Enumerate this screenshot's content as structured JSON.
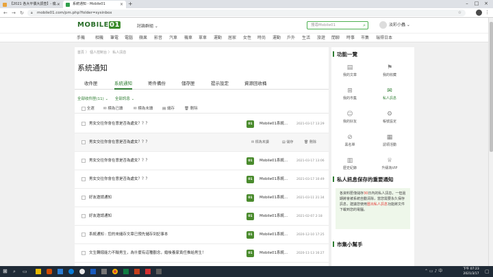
{
  "browser": {
    "tabs": [
      {
        "label": "【2021 各大平價大調查】- 瘋..."
      },
      {
        "label": "系統通知 - Mobile01"
      }
    ],
    "url": "mobile01.com/pm.php?folder=sysinbox"
  },
  "header": {
    "logo_text": "MOBILE",
    "logo_mark": "01",
    "forum_menu": "討論群組 ⌄",
    "search_placeholder": "搜尋Mobile01",
    "username": "淡彩小蟲 ⌄"
  },
  "categories": [
    "手機",
    "相機",
    "筆電",
    "電腦",
    "蘋果",
    "影音",
    "汽車",
    "機車",
    "單車",
    "運動",
    "居家",
    "女性",
    "時尚",
    "運動",
    "戶外",
    "生活",
    "旅遊",
    "閒聊",
    "時事",
    "市集",
    "瑞得日本"
  ],
  "breadcrumb": "首頁  〉 個人控制台  〉 私人訊息",
  "page_title": "系統通知",
  "tabs": [
    {
      "label": "收件匣"
    },
    {
      "label": "系統通知"
    },
    {
      "label": "寄件備份"
    },
    {
      "label": "儲存匣"
    },
    {
      "label": "提示設定"
    },
    {
      "label": "資源回收桶"
    }
  ],
  "filters": {
    "all_label": "全部收件匣(11) ⌄",
    "all_msgs": "全部訊息 ⌄"
  },
  "toolbar": {
    "select_all": "全選",
    "mark_read": "標為已讀",
    "mark_unread": "標為未讀",
    "save": "儲存",
    "delete": "刪除"
  },
  "row_actions": {
    "mark_unread": "標為未讀",
    "save": "儲存",
    "delete": "刪除"
  },
  "messages": [
    {
      "subject": "男女交往你會在意是否為處女？？？",
      "sender": "Mobile01系統...",
      "date": "2021-03-17 13:29"
    },
    {
      "subject": "男女交往你會在意是否為處女？？？",
      "sender": "",
      "date": ""
    },
    {
      "subject": "男女交往你會在意是否為處女？？？",
      "sender": "Mobile01系統...",
      "date": "2021-03-17 13:06"
    },
    {
      "subject": "男女交往你會在意是否為處女？？？",
      "sender": "Mobile01系統...",
      "date": "2021-03-17 10:49"
    },
    {
      "subject": "好友邀請通知",
      "sender": "Mobile01系統...",
      "date": "2021-03-11 21:34"
    },
    {
      "subject": "好友邀請通知",
      "sender": "Mobile01系統...",
      "date": "2021-02-07 2:18"
    },
    {
      "subject": "系統通知 : 您的來儲存文章已預先儲存到記事本",
      "sender": "Mobile01系統...",
      "date": "2020-12-10 17:25"
    },
    {
      "subject": "文生轉錢能力不輸男生，為什麼有這種觀念，婚後養家責任推給男生！",
      "sender": "Mobile01系統...",
      "date": "2020-11-13 16:27"
    }
  ],
  "sidebar": {
    "title": "功能一覽",
    "items": [
      {
        "label": "我的文章",
        "icon": "document-icon"
      },
      {
        "label": "我的收藏",
        "icon": "bookmark-icon"
      },
      {
        "label": "我的市集",
        "icon": "basket-icon"
      },
      {
        "label": "私人訊息",
        "icon": "mail-icon"
      },
      {
        "label": "我的好友",
        "icon": "people-icon"
      },
      {
        "label": "帳號設定",
        "icon": "gear-icon"
      },
      {
        "label": "黑名單",
        "icon": "block-icon"
      },
      {
        "label": "認領活動",
        "icon": "calendar-icon"
      },
      {
        "label": "歷史紀錄",
        "icon": "chart-icon"
      },
      {
        "label": "升級為VIP",
        "icon": "vip-icon"
      }
    ],
    "notice_title": "私人訊息保存的重要通知",
    "notice_1": "各資料匣僅儲存",
    "notice_days": "30",
    "notice_2": "日內的私人訊息，一但過期將會被系統自動清除，當您需要永久保存訊息，建議您使用",
    "notice_link": "匯出私人訊息",
    "notice_3": "功能將文件下載到您的電腦。",
    "market_title": "市集小幫手"
  },
  "taskbar": {
    "time": "下午 07:23",
    "date": "2021/3/17"
  },
  "accent": "#2e7d32"
}
